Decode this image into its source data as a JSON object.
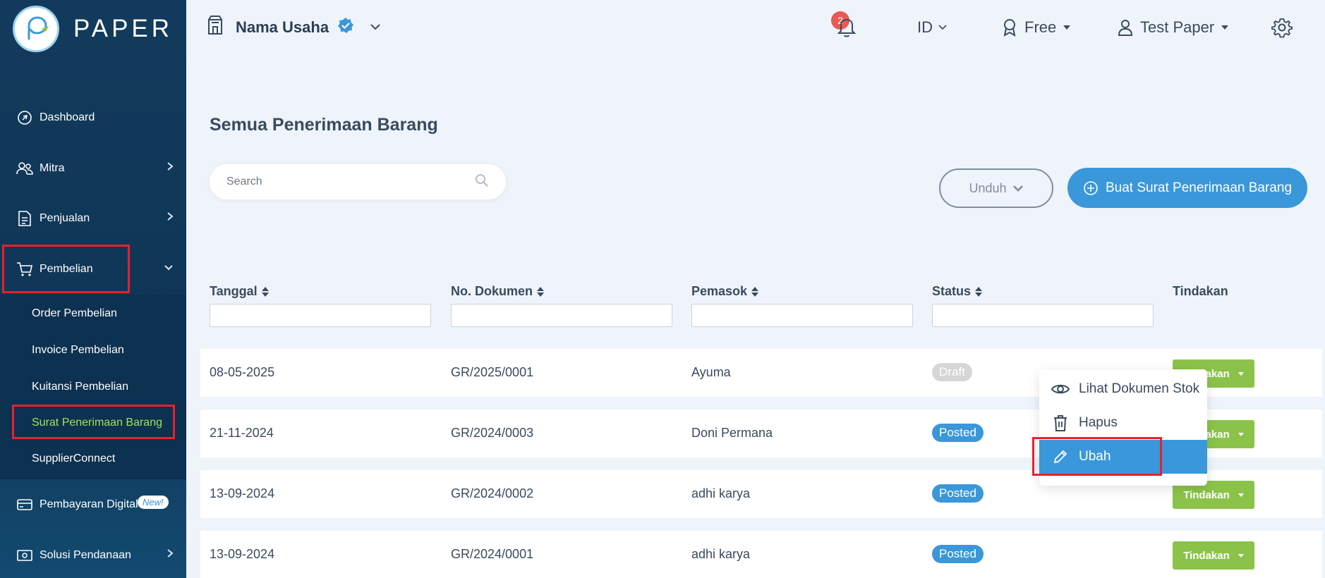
{
  "brand": {
    "name": "PAPER"
  },
  "sidebar": {
    "items": [
      {
        "label": "Dashboard",
        "icon": "dashboard-icon"
      },
      {
        "label": "Mitra",
        "icon": "partners-icon"
      },
      {
        "label": "Penjualan",
        "icon": "document-icon"
      },
      {
        "label": "Pembelian",
        "icon": "cart-icon"
      },
      {
        "label": "Pembayaran Digital",
        "icon": "card-icon"
      },
      {
        "label": "Solusi Pendanaan",
        "icon": "money-icon"
      }
    ],
    "submenu": [
      "Order Pembelian",
      "Invoice Pembelian",
      "Kuitansi Pembelian",
      "Surat Penerimaan Barang",
      "SupplierConnect"
    ],
    "new_badge": "New!"
  },
  "topbar": {
    "business_name": "Nama Usaha",
    "notification_count": "2",
    "language": "ID",
    "plan": "Free",
    "user": "Test Paper"
  },
  "main": {
    "title": "Semua Penerimaan Barang",
    "search_placeholder": "Search",
    "download_label": "Unduh",
    "create_label": "Buat Surat Penerimaan Barang"
  },
  "table": {
    "headers": [
      "Tanggal",
      "No. Dokumen",
      "Pemasok",
      "Status",
      "Tindakan"
    ],
    "action_label": "Tindakan",
    "rows": [
      {
        "date": "08-05-2025",
        "doc": "GR/2025/0001",
        "supplier": "Ayuma",
        "status": "Draft"
      },
      {
        "date": "21-11-2024",
        "doc": "GR/2024/0003",
        "supplier": "Doni Permana",
        "status": "Posted"
      },
      {
        "date": "13-09-2024",
        "doc": "GR/2024/0002",
        "supplier": "adhi karya",
        "status": "Posted"
      },
      {
        "date": "13-09-2024",
        "doc": "GR/2024/0001",
        "supplier": "adhi karya",
        "status": "Posted"
      }
    ]
  },
  "dropdown": {
    "items": [
      {
        "label": "Lihat Dokumen Stok",
        "icon": "eye-icon"
      },
      {
        "label": "Hapus",
        "icon": "trash-icon"
      },
      {
        "label": "Ubah",
        "icon": "pencil-icon"
      }
    ]
  },
  "colors": {
    "sidebar": "#123a5c",
    "primary": "#3a97d9",
    "action_green": "#8bc34a",
    "active_submenu": "#9ee55b",
    "highlight_box": "#e8212a"
  }
}
